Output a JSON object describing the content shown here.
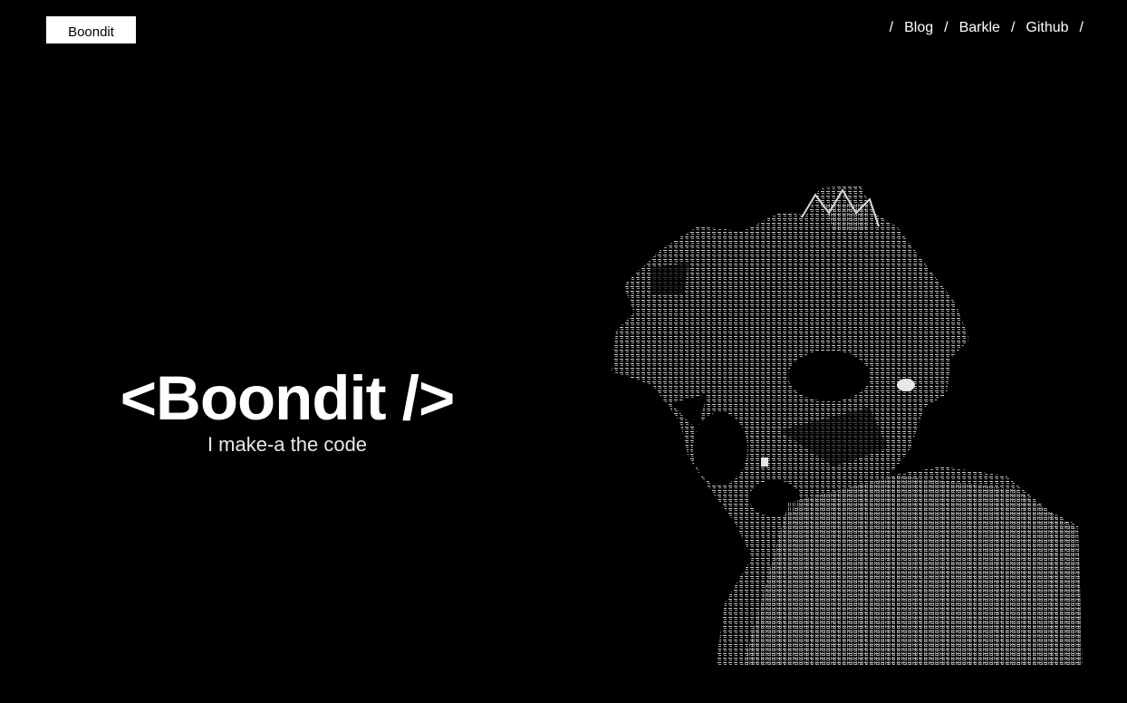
{
  "header": {
    "logo_label": "Boondit"
  },
  "nav": {
    "items": [
      {
        "label": "Blog"
      },
      {
        "label": "Barkle"
      },
      {
        "label": "Github"
      }
    ],
    "separator": "/"
  },
  "hero": {
    "title": "<Boondit />",
    "tagline": "I make-a the code"
  },
  "art": {
    "icon": "ascii-portrait-image",
    "color": "#bdbdbd"
  }
}
